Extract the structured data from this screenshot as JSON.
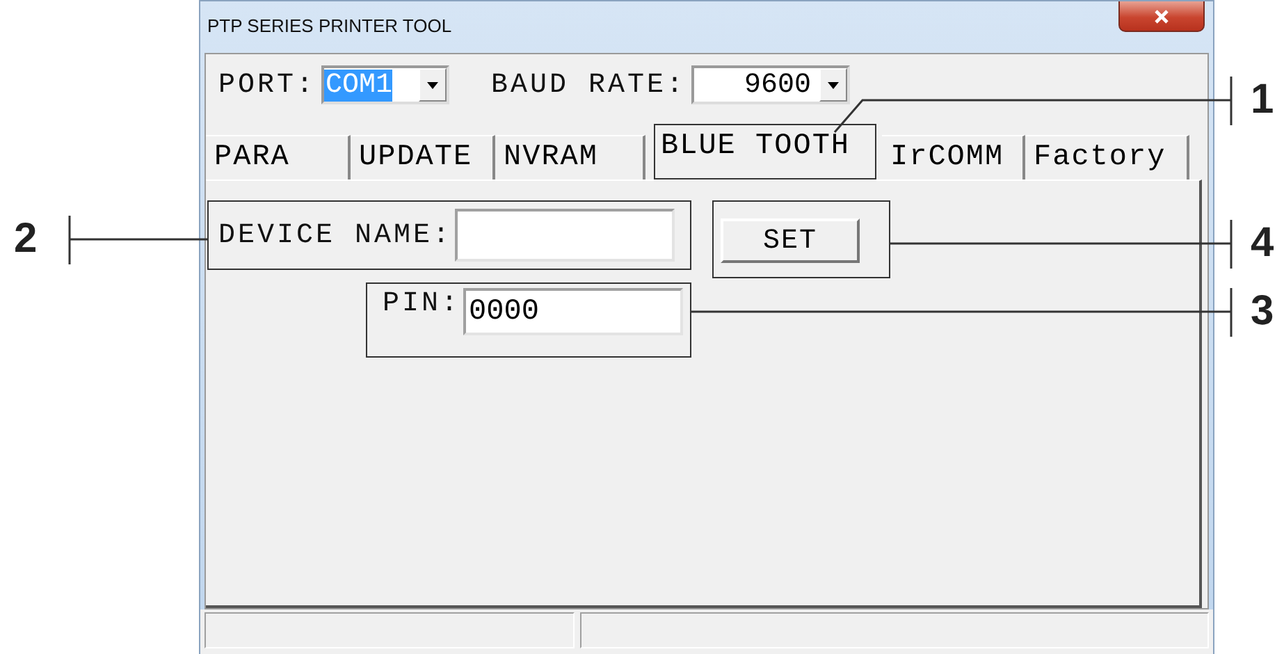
{
  "window": {
    "title": "PTP SERIES PRINTER TOOL"
  },
  "port": {
    "label": "PORT:",
    "value": "COM1",
    "selected": true
  },
  "baud_rate": {
    "label": "BAUD RATE:",
    "value": "9600",
    "selected": false
  },
  "tabs": [
    {
      "label": "PARA",
      "selected": false
    },
    {
      "label": "UPDATE",
      "selected": false
    },
    {
      "label": "NVRAM",
      "selected": false
    },
    {
      "label": "BLUE TOOTH",
      "selected": true
    },
    {
      "label": "IrCOMM",
      "selected": false
    },
    {
      "label": "Factory",
      "selected": false
    }
  ],
  "device_name": {
    "label": "DEVICE NAME:"
  },
  "set_button": "SET",
  "pin": {
    "label": "PIN:",
    "value": "0000"
  },
  "callouts": [
    {
      "number": "1"
    },
    {
      "number": "2"
    },
    {
      "number": "4"
    },
    {
      "number": "3"
    }
  ]
}
